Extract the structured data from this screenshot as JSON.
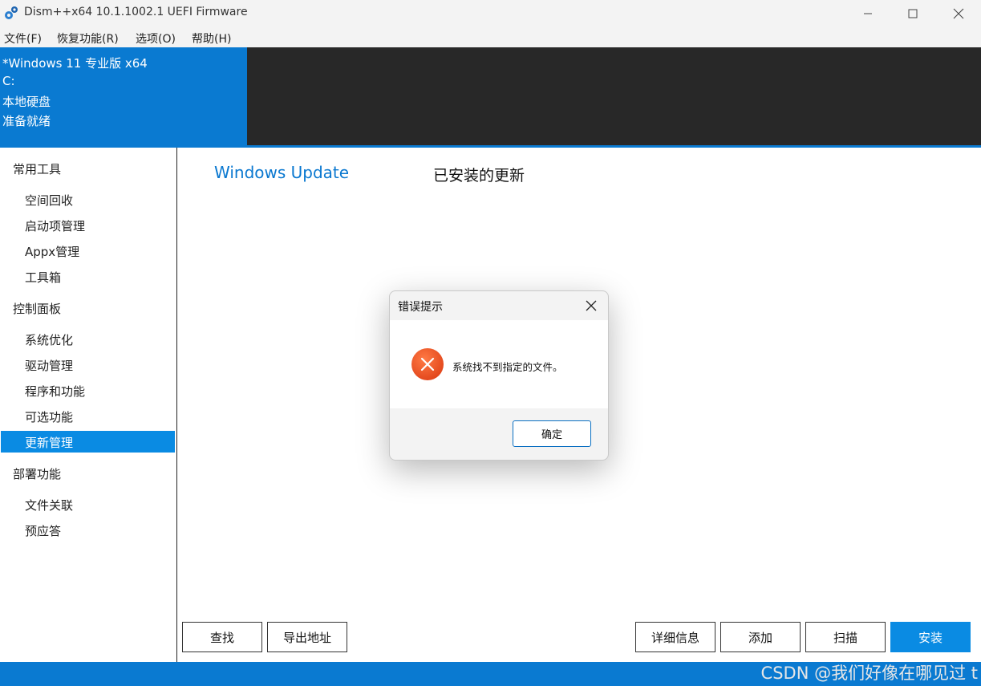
{
  "window": {
    "title": "Dism++x64 10.1.1002.1 UEFI Firmware",
    "icon": "gears-icon",
    "controls": [
      "minimize-icon",
      "maximize-icon",
      "close-icon"
    ]
  },
  "menu": {
    "file": "文件(F)",
    "restore": "恢复功能(R)",
    "options": "选项(O)",
    "help": "帮助(H)"
  },
  "image_info": {
    "name": "*Windows 11 专业版 x64",
    "drive": "C:",
    "disk_type": "本地硬盘",
    "status": "准备就绪"
  },
  "sidebar": {
    "categories": [
      {
        "label": "常用工具",
        "items": [
          "空间回收",
          "启动项管理",
          "Appx管理",
          "工具箱"
        ]
      },
      {
        "label": "控制面板",
        "items": [
          "系统优化",
          "驱动管理",
          "程序和功能",
          "可选功能",
          "更新管理"
        ]
      },
      {
        "label": "部署功能",
        "items": [
          "文件关联",
          "预应答"
        ]
      }
    ],
    "selected": "更新管理"
  },
  "main": {
    "title": "Windows Update",
    "subtitle": "已安装的更新"
  },
  "buttons": {
    "search": "查找",
    "export": "导出地址",
    "details": "详细信息",
    "add": "添加",
    "scan": "扫描",
    "install": "安装"
  },
  "dialog": {
    "title": "错误提示",
    "message": "系统找不到指定的文件。",
    "ok": "确定",
    "icon": "error-icon"
  },
  "watermark": "CSDN @我们好像在哪见过 t",
  "colors": {
    "accent": "#0a7ad1",
    "selected": "#0a8be3",
    "header_dark": "#282828",
    "title_blue": "#0a78d0",
    "error_red": "#e5461a"
  }
}
